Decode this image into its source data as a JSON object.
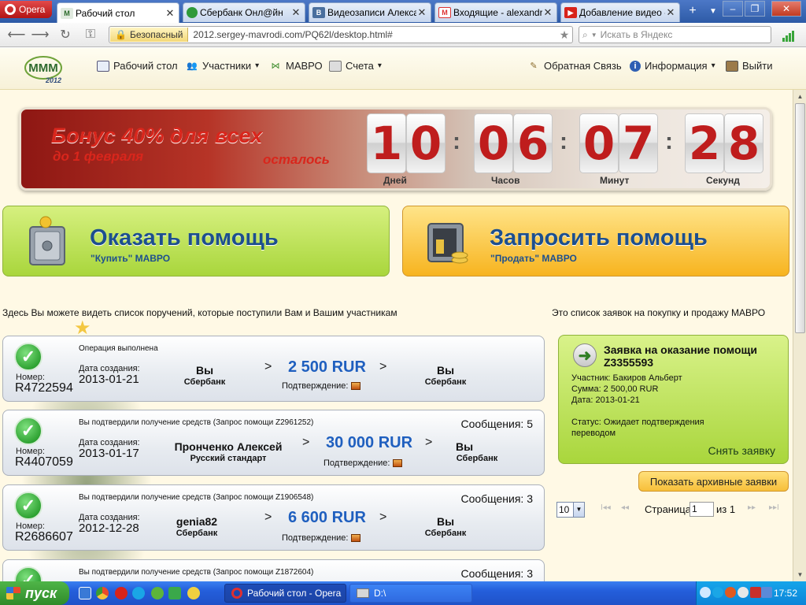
{
  "browser": {
    "menu_label": "Opera",
    "tabs": [
      {
        "label": "Рабочий стол",
        "icon": "mmm-icon",
        "active": true
      },
      {
        "label": "Сбербанк Онл@йн",
        "icon": "sberbank-icon",
        "active": false
      },
      {
        "label": "Видеозаписи Алекса...",
        "icon": "vk-icon",
        "active": false
      },
      {
        "label": "Входящие - alexandr...",
        "icon": "gmail-icon",
        "active": false
      },
      {
        "label": "Добавление видео -...",
        "icon": "youtube-icon",
        "active": false
      }
    ],
    "new_tab": "+",
    "window_controls": {
      "minimize": "‒",
      "restore": "❐",
      "close": "✕"
    },
    "security_badge": "Безопасный",
    "url": "2012.sergey-mavrodi.com/PQ62l/desktop.html#",
    "search_placeholder": "Искать в Яндекс"
  },
  "site": {
    "logo_text": "MMM",
    "logo_year": "2012",
    "nav": {
      "desktop": "Рабочий стол",
      "participants": "Участники",
      "mavro": "МАВРО",
      "accounts": "Счета",
      "feedback": "Обратная Связь",
      "info": "Информация",
      "logout": "Выйти"
    },
    "dropdown_arrow": "▾"
  },
  "banner": {
    "bonus": "Бонус 40% для всех",
    "until": "до 1 февраля",
    "left": "осталось",
    "colon": ":",
    "countdown": {
      "days": [
        "1",
        "0"
      ],
      "hours": [
        "0",
        "6"
      ],
      "minutes": [
        "0",
        "7"
      ],
      "seconds": [
        "2",
        "8"
      ]
    },
    "labels": {
      "days": "Дней",
      "hours": "Часов",
      "minutes": "Минут",
      "seconds": "Секунд"
    }
  },
  "actions": {
    "offer": {
      "title": "Оказать помощь",
      "subtitle": "\"Купить\" МАВРО"
    },
    "request": {
      "title": "Запросить помощь",
      "subtitle": "\"Продать\" МАВРО"
    }
  },
  "left_text": "Здесь Вы можете видеть список поручений, которые поступили Вам и Вашим участникам",
  "right_text": "Это список заявок на покупку и продажу МАВРО",
  "order_labels": {
    "number": "Номер:",
    "created": "Дата создания:",
    "confirmation": "Подтверждение:",
    "arrow": ">"
  },
  "orders": [
    {
      "status": "Операция выполнена",
      "messages": "",
      "number": "R4722594",
      "date": "2013-01-21",
      "from_name": "Вы",
      "from_bank": "Сбербанк",
      "amount": "2 500 RUR",
      "to_name": "Вы",
      "to_bank": "Сбербанк"
    },
    {
      "status": "Вы подтвердили получение средств (Запрос помощи Z2961252)",
      "messages": "Сообщения: 5",
      "number": "R4407059",
      "date": "2013-01-17",
      "from_name": "Пронченко Алексей",
      "from_bank": "Русский стандарт",
      "amount": "30 000 RUR",
      "to_name": "Вы",
      "to_bank": "Сбербанк"
    },
    {
      "status": "Вы подтвердили получение средств (Запрос помощи Z1906548)",
      "messages": "Сообщения: 3",
      "number": "R2686607",
      "date": "2012-12-28",
      "from_name": "genia82",
      "from_bank": "Сбербанк",
      "amount": "6 600 RUR",
      "to_name": "Вы",
      "to_bank": "Сбербанк"
    },
    {
      "status": "Вы подтвердили получение средств (Запрос помощи Z1872604)",
      "messages": "Сообщения: 3"
    }
  ],
  "request_card": {
    "title": "Заявка на оказание помощи",
    "id": "Z3355593",
    "participant": "Участник: Бакиров Альберт",
    "sum": "Сумма: 2 500,00 RUR",
    "date": "Дата: 2013-01-21",
    "status_line1": "Статус: Ожидает подтверждения",
    "status_line2": "переводом",
    "cancel": "Снять заявку"
  },
  "archive_button": "Показать архивные заявки",
  "pager": {
    "page_size": "10",
    "first": "I◂◂",
    "prev": "◂◂",
    "next": "▸▸",
    "last": "▸▸I",
    "page_label": "Страница",
    "page": "1",
    "of_label": "из 1"
  },
  "taskbar": {
    "start": "пуск",
    "tasks": [
      {
        "label": "Рабочий стол - Opera",
        "active": true
      },
      {
        "label": "D:\\",
        "active": false
      }
    ],
    "time": "17:52"
  },
  "colors": {
    "accent_blue": "#1d4f8e",
    "amount_blue": "#1f5fbf",
    "countdown_red": "#bf1d1d",
    "green_button": "#a9d63c",
    "orange_button": "#f7b41f"
  }
}
